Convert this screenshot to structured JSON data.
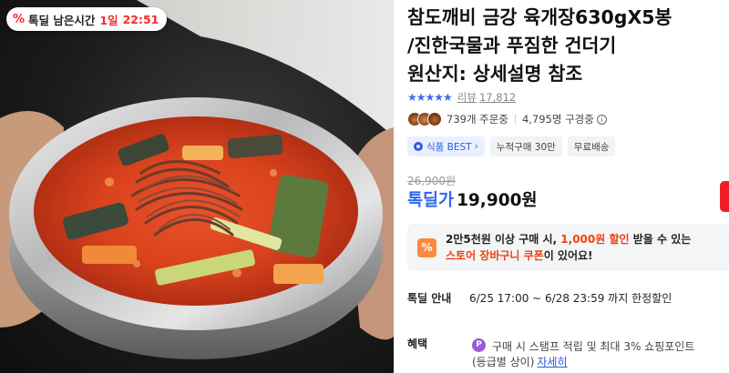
{
  "product": {
    "image_alt": "육개장 한 그릇",
    "timer": {
      "icon": "percent-icon",
      "icon_text": "%",
      "label": "톡딜 남은시간",
      "days": "1일",
      "time": "22:51"
    },
    "title": "참도깨비 금강 육개장630gX5봉\n/진한국물과 푸짐한 건더기\n원산지: 상세설명 참조",
    "rating": {
      "stars_text": "★★★★★",
      "stars_value": 5,
      "review_label": "리뷰",
      "review_count": "17,812"
    },
    "stats": {
      "orders": "739개 주문중",
      "viewers": "4,795명 구경중",
      "info_icon_text": "i"
    },
    "tags": [
      {
        "label": "식품 BEST",
        "icon": "shield-icon",
        "arrow": "›"
      },
      {
        "label": "누적구매 30만"
      },
      {
        "label": "무료배송"
      }
    ],
    "price": {
      "original": "26,900원",
      "deal_label": "톡딜가",
      "sale": "19,900원"
    },
    "coupon": {
      "icon_text": "%",
      "part1": "2만5천원 이상 구매 시, ",
      "highlight1": "1,000원 할인",
      "part2": " 받을 수 있는",
      "highlight2": "스토어 장바구니 쿠폰",
      "part3": "이 있어요!"
    },
    "deal_info": {
      "label": "톡딜 안내",
      "value": "6/25 17:00 ~ 6/28 23:59 까지 한정할인"
    },
    "benefit": {
      "label": "혜택",
      "icon_text": "P",
      "line1": "구매 시 스탬프 적립 및 최대 3% 쇼핑포인트",
      "line2": "(등급별 상이)",
      "link": "자세히"
    },
    "colors": {
      "accent_red": "#fa2828",
      "deal_blue": "#2f67f2",
      "coupon_orange": "#f0410f",
      "star_blue": "#3b6cf6"
    }
  }
}
